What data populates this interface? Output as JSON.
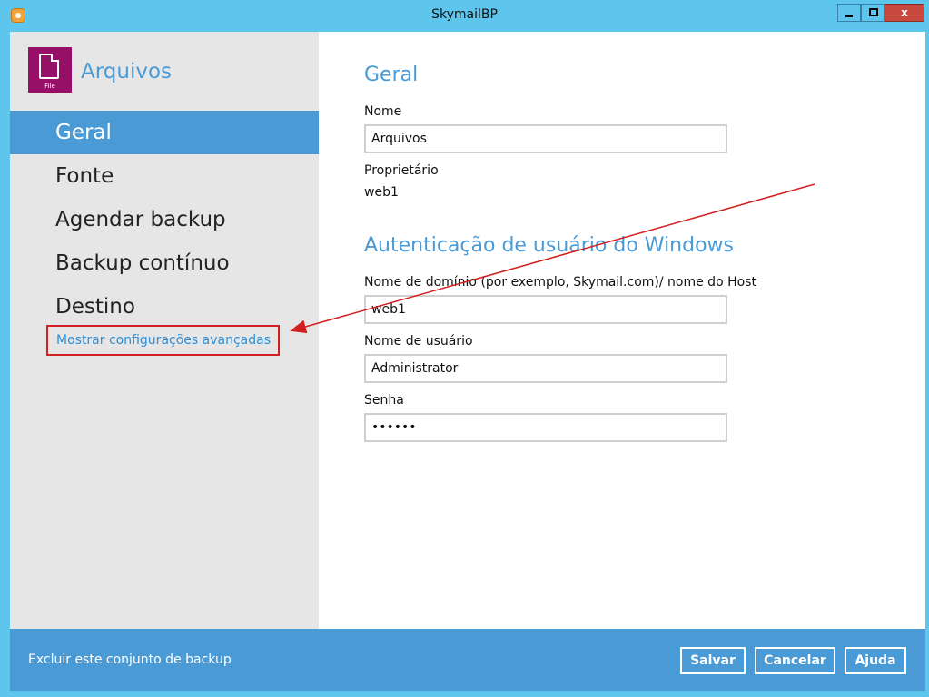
{
  "window": {
    "title": "SkymailBP",
    "controls": {
      "minimize": "",
      "maximize": "",
      "close": "x"
    }
  },
  "sidebar": {
    "brand": {
      "icon_label": "File",
      "title": "Arquivos"
    },
    "items": [
      {
        "label": "Geral",
        "active": true
      },
      {
        "label": "Fonte",
        "active": false
      },
      {
        "label": "Agendar backup",
        "active": false
      },
      {
        "label": "Backup contínuo",
        "active": false
      },
      {
        "label": "Destino",
        "active": false
      }
    ],
    "advanced_link": "Mostrar configurações avançadas"
  },
  "main": {
    "general": {
      "title": "Geral",
      "name_label": "Nome",
      "name_value": "Arquivos",
      "owner_label": "Proprietário",
      "owner_value": "web1"
    },
    "auth": {
      "title": "Autenticação de usuário do Windows",
      "domain_label": "Nome de domínio (por exemplo, Skymail.com)/ nome do Host",
      "domain_value": "web1",
      "user_label": "Nome de usuário",
      "user_value": "Administrator",
      "password_label": "Senha",
      "password_value": "••••••"
    }
  },
  "footer": {
    "delete_label": "Excluir este conjunto de backup",
    "save_label": "Salvar",
    "cancel_label": "Cancelar",
    "help_label": "Ajuda"
  },
  "colors": {
    "titlebar": "#5ec5ec",
    "accent": "#4a9ad6",
    "brand_tile": "#961068",
    "annotation_red": "#d21f1f"
  }
}
